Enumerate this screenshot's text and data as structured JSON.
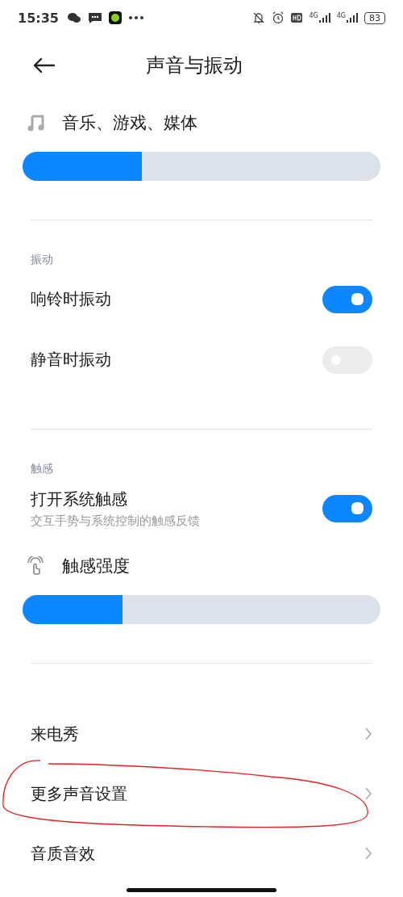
{
  "status_bar": {
    "time": "15:35",
    "network_labels": [
      "4G",
      "4G"
    ],
    "battery": "83"
  },
  "header": {
    "title": "声音与振动"
  },
  "volume": {
    "label": "音乐、游戏、媒体",
    "level": 0.333
  },
  "sections": [
    {
      "title": "振动",
      "rows": [
        {
          "kind": "toggle",
          "label": "响铃时振动",
          "on": true
        },
        {
          "kind": "toggle",
          "label": "静音时振动",
          "on": false
        }
      ]
    },
    {
      "title": "触感",
      "rows": [
        {
          "kind": "toggle",
          "label": "打开系统触感",
          "subtitle": "交互手势与系统控制的触感反馈",
          "on": true
        },
        {
          "kind": "slider",
          "label": "触感强度",
          "level": 0.28
        }
      ]
    }
  ],
  "links": [
    {
      "label": "来电秀",
      "circled": false
    },
    {
      "label": "更多声音设置",
      "circled": true
    },
    {
      "label": "音质音效",
      "circled": false
    }
  ]
}
